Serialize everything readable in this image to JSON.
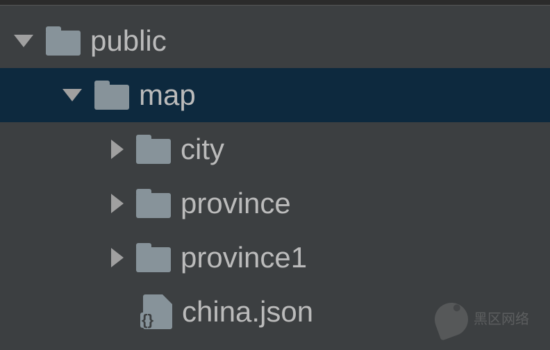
{
  "tree": {
    "root": {
      "label": "public",
      "expanded": true,
      "children": [
        {
          "label": "map",
          "expanded": true,
          "selected": true,
          "children": [
            {
              "label": "city",
              "type": "folder",
              "expanded": false
            },
            {
              "label": "province",
              "type": "folder",
              "expanded": false
            },
            {
              "label": "province1",
              "type": "folder",
              "expanded": false
            },
            {
              "label": "china.json",
              "type": "file"
            }
          ]
        }
      ]
    }
  },
  "watermark": {
    "line1": "黑区网络",
    "line2": ""
  }
}
